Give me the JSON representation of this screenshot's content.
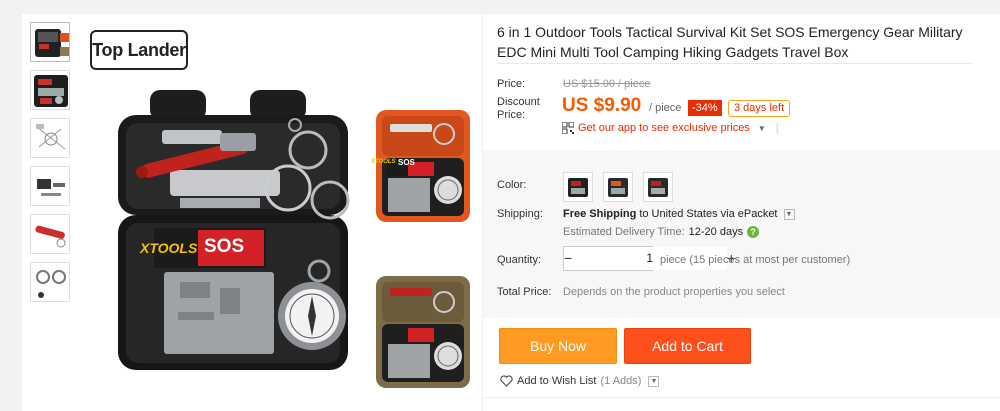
{
  "gallery": {
    "brand_logo_text": "Top Lander",
    "thumbnails": [
      {
        "name": "kit-black-open"
      },
      {
        "name": "kit-black-items"
      },
      {
        "name": "kit-diagram"
      },
      {
        "name": "kit-tools-laid-out"
      },
      {
        "name": "kit-whistle"
      },
      {
        "name": "kit-wire-saw"
      }
    ],
    "image_labels": {
      "xtools": "XTOOLS",
      "sos": "SOS"
    }
  },
  "product": {
    "title": "6 in 1 Outdoor Tools Tactical Survival Kit Set SOS Emergency Gear Military EDC Mini Multi Tool Camping Hiking Gadgets Travel Box",
    "price_label": "Price:",
    "original_price": "US $15.00 / piece",
    "discount_label": "Discount Price:",
    "discount_price": "US $9.90",
    "per_unit": "/ piece",
    "discount_badge": "-34%",
    "days_left": "3 days left",
    "app_promo": "Get our app to see exclusive prices",
    "color_label": "Color:",
    "colors": [
      {
        "name": "black-kit"
      },
      {
        "name": "orange-kit"
      },
      {
        "name": "khaki-kit"
      }
    ],
    "shipping_label": "Shipping:",
    "shipping_free": "Free Shipping",
    "shipping_to": "to",
    "shipping_dest": "United States via ePacket",
    "delivery_label": "Estimated Delivery Time:",
    "delivery_days": "12-20 days",
    "quantity_label": "Quantity:",
    "quantity_value": "1",
    "quantity_note": "piece (15 pieces at most per customer)",
    "total_label": "Total Price:",
    "total_note": "Depends on the product properties you select",
    "buy_now": "Buy Now",
    "add_to_cart": "Add to Cart",
    "wishlist": "Add to Wish List",
    "wishlist_count": "(1 Adds)"
  },
  "colors": {
    "price_orange": "#f55a00",
    "badge_red": "#e62e04",
    "buy_orange": "#ff9a23",
    "cart_red": "#ff4f1a"
  }
}
